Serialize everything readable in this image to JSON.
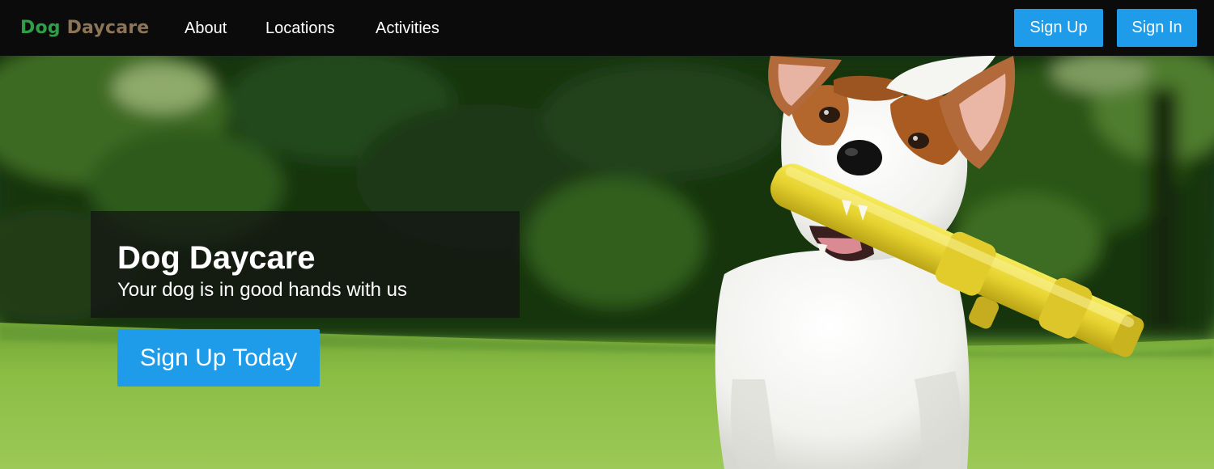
{
  "navbar": {
    "brand": {
      "word1": "Dog",
      "word2": "Daycare",
      "word1_color": "#2e9e49",
      "word2_color": "#8d7457"
    },
    "links": [
      {
        "label": "About"
      },
      {
        "label": "Locations"
      },
      {
        "label": "Activities"
      }
    ],
    "buttons": {
      "signup_label": "Sign Up",
      "signin_label": "Sign In",
      "color": "#1e9cea"
    }
  },
  "hero": {
    "title": "Dog Daycare",
    "subtitle": "Your dog is in good hands with us",
    "cta_label": "Sign Up Today",
    "image": {
      "subject": "dog-running-with-yellow-toy-image"
    }
  }
}
